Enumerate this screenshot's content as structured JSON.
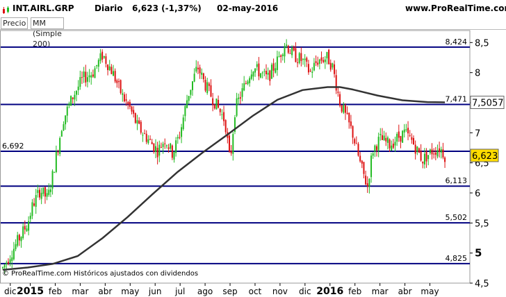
{
  "header": {
    "symbol": "INT.AIRL.GRP",
    "period": "Diario",
    "quote": "6,623 (-1,37%)",
    "date": "02-may-2016",
    "site": "www.ProRealTime.com"
  },
  "indicators": [
    "Precio",
    "MM (Simple 200)"
  ],
  "credit": "© ProRealTime.com Históricos ajustados con dividendos",
  "colors": {
    "up": "#22bb22",
    "down": "#dd1111",
    "ma": "#333333",
    "hline": "#000080",
    "tag_bg": "#ffdd00"
  },
  "chart_data": {
    "type": "candlestick",
    "ylim": [
      4.5,
      8.7
    ],
    "y_ticks": [
      "4,5",
      "5",
      "5,5",
      "6",
      "6,5",
      "7",
      "7,5",
      "8",
      "8,5"
    ],
    "x_ticks": [
      {
        "label": "dic",
        "bold": false
      },
      {
        "label": "2015",
        "bold": true
      },
      {
        "label": "feb",
        "bold": false
      },
      {
        "label": "mar",
        "bold": false
      },
      {
        "label": "abr",
        "bold": false
      },
      {
        "label": "may",
        "bold": false
      },
      {
        "label": "jun",
        "bold": false
      },
      {
        "label": "jul",
        "bold": false
      },
      {
        "label": "ago",
        "bold": false
      },
      {
        "label": "sep",
        "bold": false
      },
      {
        "label": "oct",
        "bold": false
      },
      {
        "label": "nov",
        "bold": false
      },
      {
        "label": "dic",
        "bold": false
      },
      {
        "label": "2016",
        "bold": true
      },
      {
        "label": "feb",
        "bold": false
      },
      {
        "label": "mar",
        "bold": false
      },
      {
        "label": "abr",
        "bold": false
      },
      {
        "label": "may",
        "bold": false
      }
    ],
    "x_tick_pos": [
      0.3,
      1.1,
      2.1,
      3.1,
      4.1,
      5.1,
      6.1,
      7.1,
      8.1,
      9.1,
      10.1,
      11.1,
      12.1,
      13.1,
      14.1,
      15.1,
      16.1,
      17.1
    ],
    "x_max": 18.7,
    "horizontal_levels": [
      {
        "value": 8.424,
        "label": "8,424",
        "label_side": "right"
      },
      {
        "value": 7.471,
        "label": "7,471",
        "label_side": "right"
      },
      {
        "value": 6.692,
        "label": "6,692",
        "label_side": "left"
      },
      {
        "value": 6.113,
        "label": "6,113",
        "label_side": "right"
      },
      {
        "value": 5.502,
        "label": "5,502",
        "label_side": "right"
      },
      {
        "value": 4.825,
        "label": "4,825",
        "label_side": "right"
      }
    ],
    "moving_average": {
      "name": "MM (Simple 200)",
      "last_label": "7,5057",
      "last_value": 7.5057,
      "points": [
        [
          0.0,
          4.72
        ],
        [
          1.0,
          4.76
        ],
        [
          2.0,
          4.82
        ],
        [
          3.0,
          4.95
        ],
        [
          4.0,
          5.25
        ],
        [
          5.0,
          5.6
        ],
        [
          6.0,
          5.98
        ],
        [
          7.0,
          6.35
        ],
        [
          8.0,
          6.67
        ],
        [
          9.0,
          6.97
        ],
        [
          10.0,
          7.28
        ],
        [
          11.0,
          7.55
        ],
        [
          12.0,
          7.71
        ],
        [
          13.0,
          7.76
        ],
        [
          13.5,
          7.76
        ],
        [
          14.0,
          7.72
        ],
        [
          15.0,
          7.62
        ],
        [
          16.0,
          7.54
        ],
        [
          17.0,
          7.51
        ],
        [
          17.7,
          7.5057
        ]
      ]
    },
    "price": {
      "name": "Precio",
      "last_label": "6,623",
      "last_value": 6.623,
      "anchors": [
        [
          0.0,
          4.75
        ],
        [
          1.0,
          5.5
        ],
        [
          1.2,
          5.8
        ],
        [
          1.5,
          6.05
        ],
        [
          1.8,
          5.9
        ],
        [
          2.0,
          6.3
        ],
        [
          2.4,
          7.2
        ],
        [
          2.8,
          7.6
        ],
        [
          3.2,
          7.9
        ],
        [
          3.6,
          8.0
        ],
        [
          4.0,
          8.3
        ],
        [
          4.4,
          8.0
        ],
        [
          4.8,
          7.6
        ],
        [
          5.1,
          7.4
        ],
        [
          5.4,
          7.1
        ],
        [
          5.8,
          6.9
        ],
        [
          6.2,
          6.7
        ],
        [
          6.5,
          6.9
        ],
        [
          6.8,
          6.65
        ],
        [
          7.1,
          7.0
        ],
        [
          7.4,
          7.6
        ],
        [
          7.8,
          8.1
        ],
        [
          8.1,
          7.8
        ],
        [
          8.5,
          7.5
        ],
        [
          8.9,
          7.2
        ],
        [
          9.1,
          6.5
        ],
        [
          9.3,
          7.4
        ],
        [
          9.7,
          7.8
        ],
        [
          10.0,
          8.1
        ],
        [
          10.3,
          8.0
        ],
        [
          10.6,
          7.9
        ],
        [
          11.0,
          8.2
        ],
        [
          11.3,
          8.5
        ],
        [
          11.6,
          8.3
        ],
        [
          12.0,
          8.2
        ],
        [
          12.3,
          8.0
        ],
        [
          12.6,
          8.2
        ],
        [
          13.0,
          8.25
        ],
        [
          13.2,
          8.1
        ],
        [
          13.5,
          7.5
        ],
        [
          13.8,
          7.2
        ],
        [
          14.0,
          7.0
        ],
        [
          14.3,
          6.5
        ],
        [
          14.6,
          6.1
        ],
        [
          14.8,
          6.7
        ],
        [
          15.1,
          6.9
        ],
        [
          15.5,
          6.8
        ],
        [
          15.9,
          6.95
        ],
        [
          16.1,
          7.0
        ],
        [
          16.4,
          6.85
        ],
        [
          16.8,
          6.55
        ],
        [
          17.2,
          6.7
        ],
        [
          17.5,
          6.75
        ],
        [
          17.7,
          6.623
        ]
      ]
    }
  }
}
